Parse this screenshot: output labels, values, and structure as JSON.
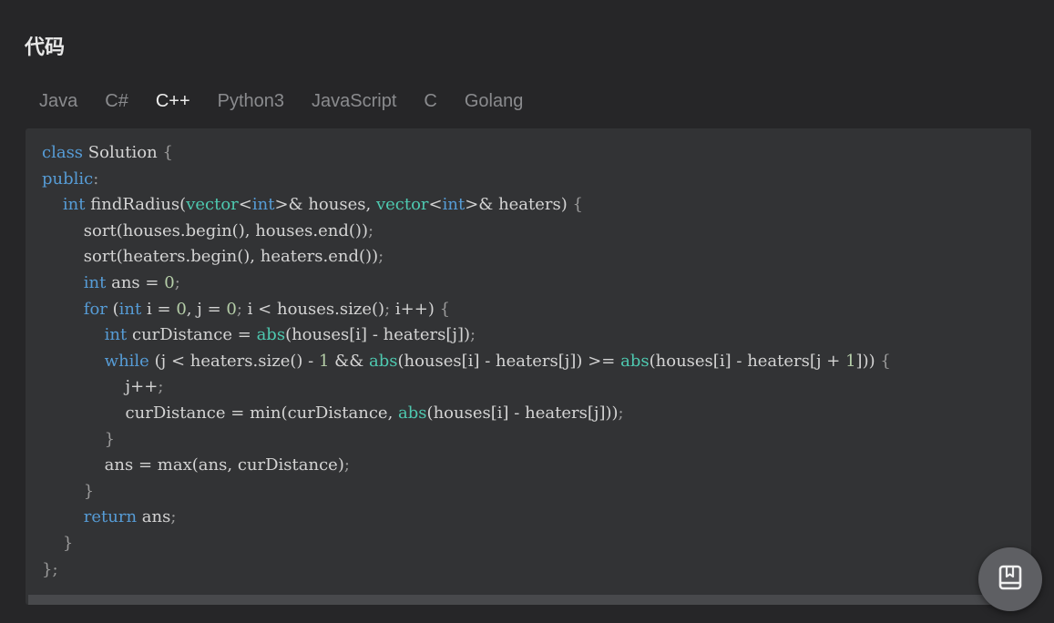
{
  "page": {
    "title": "代码"
  },
  "tabs": [
    {
      "label": "Java"
    },
    {
      "label": "C#"
    },
    {
      "label": "C++"
    },
    {
      "label": "Python3"
    },
    {
      "label": "JavaScript"
    },
    {
      "label": "C"
    },
    {
      "label": "Golang"
    }
  ],
  "active_tab": "C++",
  "code": {
    "language": "C++",
    "lines": [
      "class Solution {",
      "public:",
      "    int findRadius(vector<int>& houses, vector<int>& heaters) {",
      "        sort(houses.begin(), houses.end());",
      "        sort(heaters.begin(), heaters.end());",
      "        int ans = 0;",
      "        for (int i = 0, j = 0; i < houses.size(); i++) {",
      "            int curDistance = abs(houses[i] - heaters[j]);",
      "            while (j < heaters.size() - 1 && abs(houses[i] - heaters[j]) >= abs(houses[i] - heaters[j + 1])) {",
      "                j++;",
      "                curDistance = min(curDistance, abs(houses[i] - heaters[j]));",
      "            }",
      "            ans = max(ans, curDistance);",
      "        }",
      "        return ans;",
      "    }",
      "};"
    ]
  },
  "floating_button": {
    "icon": "book-icon"
  },
  "colors": {
    "background": "#262628",
    "code_panel": "#323335",
    "keyword": "#569cd6",
    "type": "#4ec9b0",
    "number": "#b5cea8",
    "text": "#d4d4d4",
    "tab_active": "#ececec",
    "tab_inactive": "#8a8b8e"
  }
}
